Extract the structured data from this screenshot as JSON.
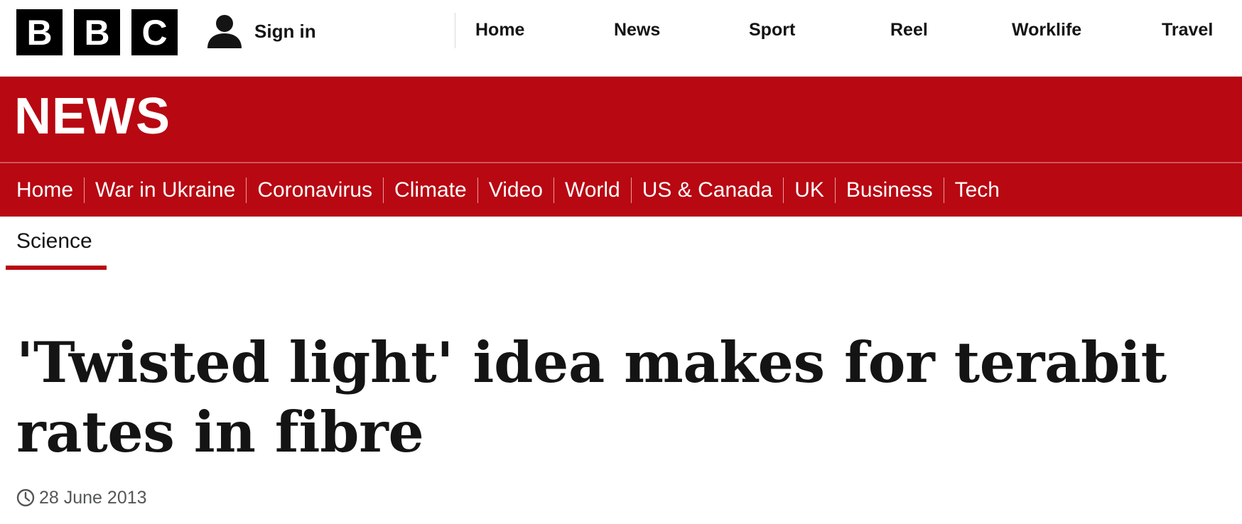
{
  "brand": {
    "logo_letters": [
      "B",
      "B",
      "C"
    ],
    "section_wordmark": "NEWS",
    "accent_color": "#b80812"
  },
  "account": {
    "signin_label": "Sign in",
    "icon": "user-icon"
  },
  "top_nav": {
    "items": [
      "Home",
      "News",
      "Sport",
      "Reel",
      "Worklife",
      "Travel"
    ]
  },
  "section_nav": {
    "items": [
      "Home",
      "War in Ukraine",
      "Coronavirus",
      "Climate",
      "Video",
      "World",
      "US & Canada",
      "UK",
      "Business",
      "Tech"
    ]
  },
  "sub_nav": {
    "active": "Science"
  },
  "article": {
    "headline": "'Twisted light' idea makes for terabit rates in fibre",
    "date": "28 June 2013",
    "date_icon": "clock-icon"
  }
}
